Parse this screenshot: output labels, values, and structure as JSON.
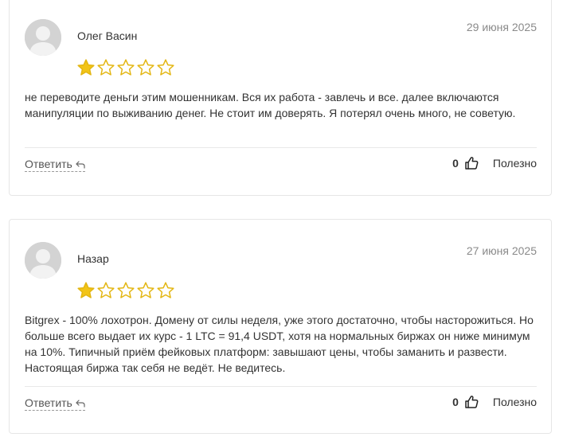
{
  "reviews": [
    {
      "author": "Олег Васин",
      "date": "29 июня 2025",
      "rating": 1,
      "rating_max": 5,
      "text": "не переводите деньги этим мошенникам. Вся их работа - завлечь и все. далее включаются манипуляции по выживанию денег. Не стоит им доверять. Я потерял очень много, не советую.",
      "reply_label": "Ответить",
      "helpful_count": "0",
      "helpful_label": "Полезно"
    },
    {
      "author": "Назар",
      "date": "27 июня 2025",
      "rating": 1,
      "rating_max": 5,
      "text": "Bitgrex - 100% лохотрон. Домену от силы неделя, уже этого достаточно, чтобы насторожиться. Но больше всего выдает их курс - 1 LTC = 91,4 USDT, хотя на нормальных биржах он ниже минимум на 10%. Типичный приём фейковых платформ: завышают цены, чтобы заманить и развести. Настоящая биржа так себя не ведёт. Не ведитесь.",
      "reply_label": "Ответить",
      "helpful_count": "0",
      "helpful_label": "Полезно"
    }
  ],
  "icons": {
    "avatar": "user-silhouette-icon",
    "star": "star-icon",
    "reply": "reply-arrow-icon",
    "helpful": "thumbs-up-icon"
  },
  "colors": {
    "star_filled": "#f2c418",
    "star_outline": "#e3b612",
    "avatar_bg": "#d3d3d3",
    "card_border": "#e6e6e6"
  }
}
